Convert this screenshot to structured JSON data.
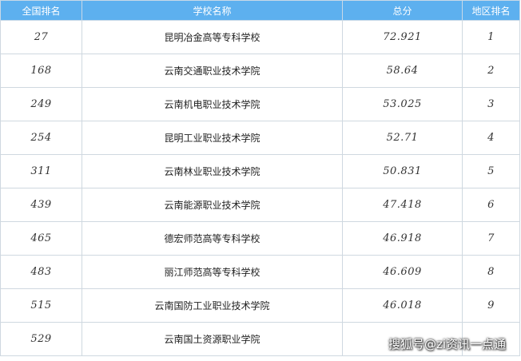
{
  "table": {
    "headers": {
      "national_rank": "全国排名",
      "school_name": "学校名称",
      "total_score": "总分",
      "region_rank": "地区排名"
    },
    "rows": [
      {
        "national_rank": "27",
        "school_name": "昆明冶金高等专科学校",
        "total_score": "72.921",
        "region_rank": "1"
      },
      {
        "national_rank": "168",
        "school_name": "云南交通职业技术学院",
        "total_score": "58.64",
        "region_rank": "2"
      },
      {
        "national_rank": "249",
        "school_name": "云南机电职业技术学院",
        "total_score": "53.025",
        "region_rank": "3"
      },
      {
        "national_rank": "254",
        "school_name": "昆明工业职业技术学院",
        "total_score": "52.71",
        "region_rank": "4"
      },
      {
        "national_rank": "311",
        "school_name": "云南林业职业技术学院",
        "total_score": "50.831",
        "region_rank": "5"
      },
      {
        "national_rank": "439",
        "school_name": "云南能源职业技术学院",
        "total_score": "47.418",
        "region_rank": "6"
      },
      {
        "national_rank": "465",
        "school_name": "德宏师范高等专科学校",
        "total_score": "46.918",
        "region_rank": "7"
      },
      {
        "national_rank": "483",
        "school_name": "丽江师范高等专科学校",
        "total_score": "46.609",
        "region_rank": "8"
      },
      {
        "national_rank": "515",
        "school_name": "云南国防工业职业技术学院",
        "total_score": "46.018",
        "region_rank": "9"
      },
      {
        "national_rank": "529",
        "school_name": "云南国土资源职业学院",
        "total_score": "",
        "region_rank": ""
      }
    ]
  },
  "watermark": "搜狐号@zi资讯一点通",
  "colors": {
    "header_bg": "#5db0ef",
    "header_text": "#ffffff",
    "border": "#cfd8e0"
  }
}
